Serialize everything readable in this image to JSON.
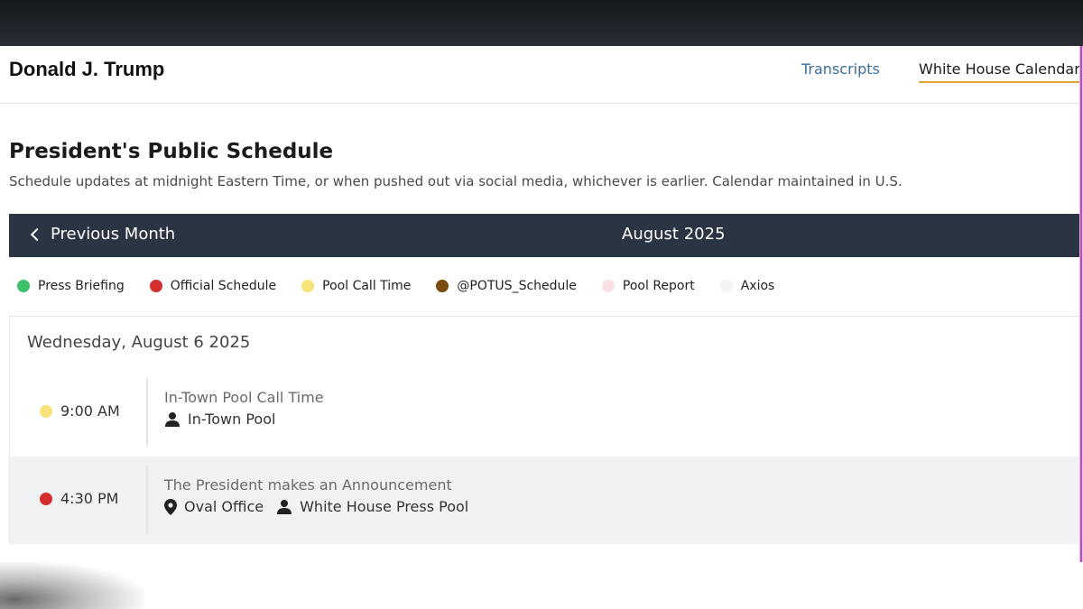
{
  "header": {
    "brand": "Donald J. Trump",
    "nav": [
      {
        "label": "Transcripts"
      },
      {
        "label": "White House Calendar",
        "active": true
      }
    ]
  },
  "schedule": {
    "title": "President's Public Schedule",
    "subtitle": "Schedule updates at midnight Eastern Time, or when pushed out via social media, whichever is earlier. Calendar maintained in U.S."
  },
  "month_bar": {
    "prev_label": "Previous Month",
    "current_month": "August 2025"
  },
  "legend": [
    {
      "label": "Press Briefing",
      "color": "#3cc06a"
    },
    {
      "label": "Official Schedule",
      "color": "#d32f2f"
    },
    {
      "label": "Pool Call Time",
      "color": "#f8e27a"
    },
    {
      "label": "@POTUS_Schedule",
      "color": "#7a4a0e"
    },
    {
      "label": "Pool Report",
      "color": "#fbe1e6"
    },
    {
      "label": "Axios",
      "color": "#f3f3f4"
    }
  ],
  "day": {
    "heading": "Wednesday, August 6 2025",
    "events": [
      {
        "time": "9:00 AM",
        "color": "#f8e27a",
        "title": "In-Town Pool Call Time",
        "attendees": "In-Town Pool",
        "attendees_icon": "person-icon"
      },
      {
        "time": "4:30 PM",
        "color": "#d32f2f",
        "title": "The President makes an Announcement",
        "location": "Oval Office",
        "location_icon": "map-pin-icon",
        "attendees": "White House Press Pool",
        "attendees_icon": "person-icon"
      }
    ]
  }
}
